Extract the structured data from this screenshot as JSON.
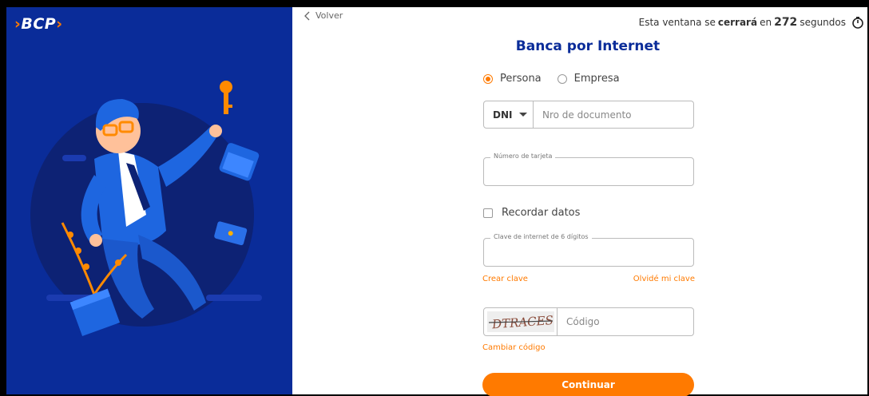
{
  "brand": {
    "logo_text": "BCP",
    "orange": "#ff7a00",
    "blue": "#0a2c99"
  },
  "nav": {
    "back_label": "Volver"
  },
  "timer": {
    "prefix": "Esta ventana se ",
    "emph": "cerrará",
    "mid": " en ",
    "seconds": "272",
    "suffix": " segundos",
    "icon": "stopwatch-icon"
  },
  "form": {
    "title": "Banca por Internet",
    "client_types": [
      {
        "label": "Persona",
        "selected": true
      },
      {
        "label": "Empresa",
        "selected": false
      }
    ],
    "doc_type": "DNI",
    "doc_placeholder": "Nro de documento",
    "card_label": "Número de tarjeta",
    "remember_label": "Recordar datos",
    "password_label": "Clave de internet de 6 dígitos",
    "create_key": "Crear clave",
    "forgot_key": "Olvidé mi clave",
    "captcha_text": "DTRACES",
    "captcha_placeholder": "Código",
    "change_code": "Cambiar código",
    "submit": "Continuar"
  }
}
